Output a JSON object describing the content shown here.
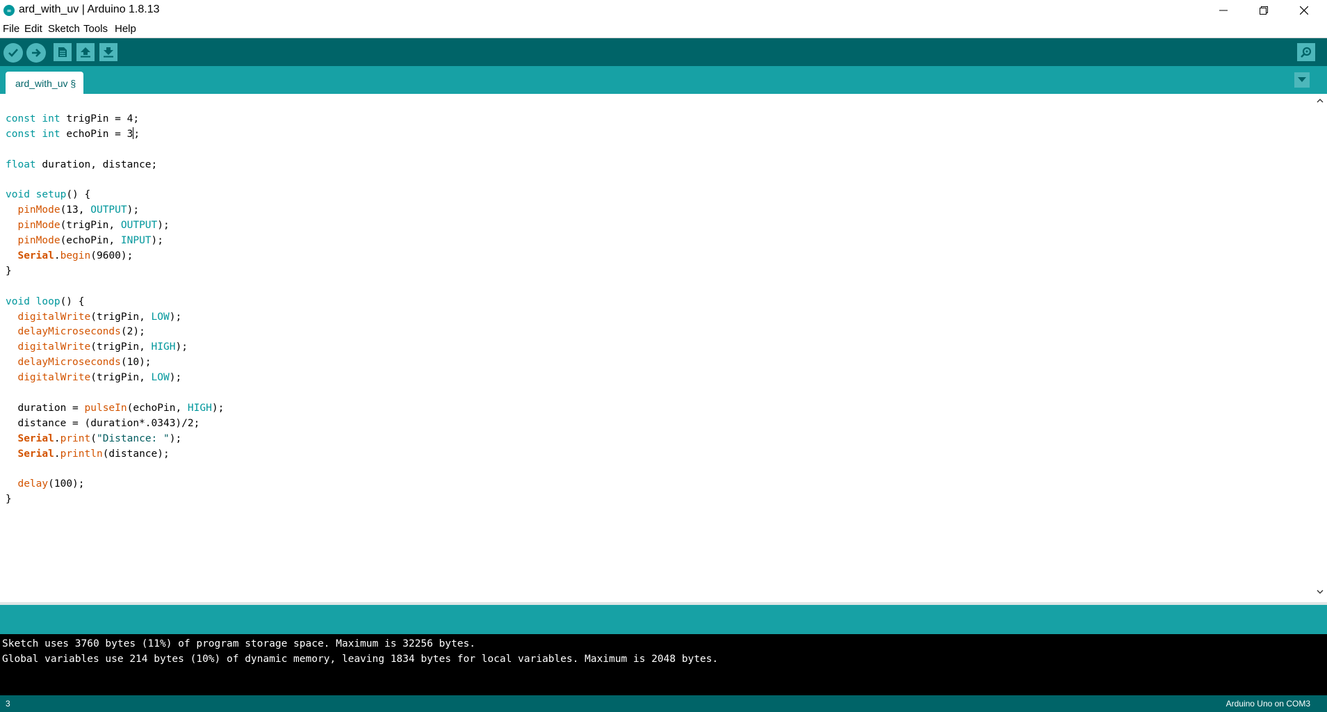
{
  "window": {
    "title": "ard_with_uv | Arduino 1.8.13",
    "app_icon": "arduino-logo-icon"
  },
  "menu": [
    "File",
    "Edit",
    "Sketch",
    "Tools",
    "Help"
  ],
  "toolbar": {
    "buttons": [
      "verify-icon",
      "upload-icon",
      "new-icon",
      "open-icon",
      "save-icon",
      "serial-monitor-icon"
    ]
  },
  "tabs": [
    {
      "label": "ard_with_uv §",
      "active": true
    }
  ],
  "editor": {
    "code_lines": [
      [
        [
          "k",
          "const"
        ],
        [
          "p",
          " "
        ],
        [
          "k",
          "int"
        ],
        [
          "p",
          " trigPin = 4;"
        ]
      ],
      [
        [
          "k",
          "const"
        ],
        [
          "p",
          " "
        ],
        [
          "k",
          "int"
        ],
        [
          "p",
          " echoPin = 3"
        ],
        [
          "caret",
          ""
        ],
        [
          "p",
          ";"
        ]
      ],
      [],
      [
        [
          "k",
          "float"
        ],
        [
          "p",
          " duration, distance;"
        ]
      ],
      [],
      [
        [
          "k",
          "void"
        ],
        [
          "p",
          " "
        ],
        [
          "k",
          "setup"
        ],
        [
          "p",
          "() {"
        ]
      ],
      [
        [
          "p",
          "  "
        ],
        [
          "f",
          "pinMode"
        ],
        [
          "p",
          "(13, "
        ],
        [
          "c",
          "OUTPUT"
        ],
        [
          "p",
          ");"
        ]
      ],
      [
        [
          "p",
          "  "
        ],
        [
          "f",
          "pinMode"
        ],
        [
          "p",
          "(trigPin, "
        ],
        [
          "c",
          "OUTPUT"
        ],
        [
          "p",
          ");"
        ]
      ],
      [
        [
          "p",
          "  "
        ],
        [
          "f",
          "pinMode"
        ],
        [
          "p",
          "(echoPin, "
        ],
        [
          "c",
          "INPUT"
        ],
        [
          "p",
          ");"
        ]
      ],
      [
        [
          "p",
          "  "
        ],
        [
          "s",
          "Serial"
        ],
        [
          "p",
          "."
        ],
        [
          "f",
          "begin"
        ],
        [
          "p",
          "(9600);"
        ]
      ],
      [
        [
          "p",
          "}"
        ]
      ],
      [],
      [
        [
          "k",
          "void"
        ],
        [
          "p",
          " "
        ],
        [
          "k",
          "loop"
        ],
        [
          "p",
          "() {"
        ]
      ],
      [
        [
          "p",
          "  "
        ],
        [
          "f",
          "digitalWrite"
        ],
        [
          "p",
          "(trigPin, "
        ],
        [
          "c",
          "LOW"
        ],
        [
          "p",
          ");"
        ]
      ],
      [
        [
          "p",
          "  "
        ],
        [
          "f",
          "delayMicroseconds"
        ],
        [
          "p",
          "(2);"
        ]
      ],
      [
        [
          "p",
          "  "
        ],
        [
          "f",
          "digitalWrite"
        ],
        [
          "p",
          "(trigPin, "
        ],
        [
          "c",
          "HIGH"
        ],
        [
          "p",
          ");"
        ]
      ],
      [
        [
          "p",
          "  "
        ],
        [
          "f",
          "delayMicroseconds"
        ],
        [
          "p",
          "(10);"
        ]
      ],
      [
        [
          "p",
          "  "
        ],
        [
          "f",
          "digitalWrite"
        ],
        [
          "p",
          "(trigPin, "
        ],
        [
          "c",
          "LOW"
        ],
        [
          "p",
          ");"
        ]
      ],
      [],
      [
        [
          "p",
          "  duration = "
        ],
        [
          "f",
          "pulseIn"
        ],
        [
          "p",
          "(echoPin, "
        ],
        [
          "c",
          "HIGH"
        ],
        [
          "p",
          ");"
        ]
      ],
      [
        [
          "p",
          "  distance = (duration*.0343)/2;"
        ]
      ],
      [
        [
          "p",
          "  "
        ],
        [
          "s",
          "Serial"
        ],
        [
          "p",
          "."
        ],
        [
          "f",
          "print"
        ],
        [
          "p",
          "("
        ],
        [
          "q",
          "\"Distance: \""
        ],
        [
          "p",
          ");"
        ]
      ],
      [
        [
          "p",
          "  "
        ],
        [
          "s",
          "Serial"
        ],
        [
          "p",
          "."
        ],
        [
          "f",
          "println"
        ],
        [
          "p",
          "(distance);"
        ]
      ],
      [],
      [
        [
          "p",
          "  "
        ],
        [
          "f",
          "delay"
        ],
        [
          "p",
          "(100);"
        ]
      ],
      [
        [
          "p",
          "}"
        ]
      ]
    ]
  },
  "console": {
    "lines": [
      "Sketch uses 3760 bytes (11%) of program storage space. Maximum is 32256 bytes.",
      "Global variables use 214 bytes (10%) of dynamic memory, leaving 1834 bytes for local variables. Maximum is 2048 bytes."
    ]
  },
  "status": {
    "line_number": "3",
    "board": "Arduino Uno on COM3"
  },
  "colors": {
    "toolbar_bg": "#006468",
    "tabbar_bg": "#17a1a5",
    "keyword": "#00979c",
    "function": "#d35400"
  }
}
